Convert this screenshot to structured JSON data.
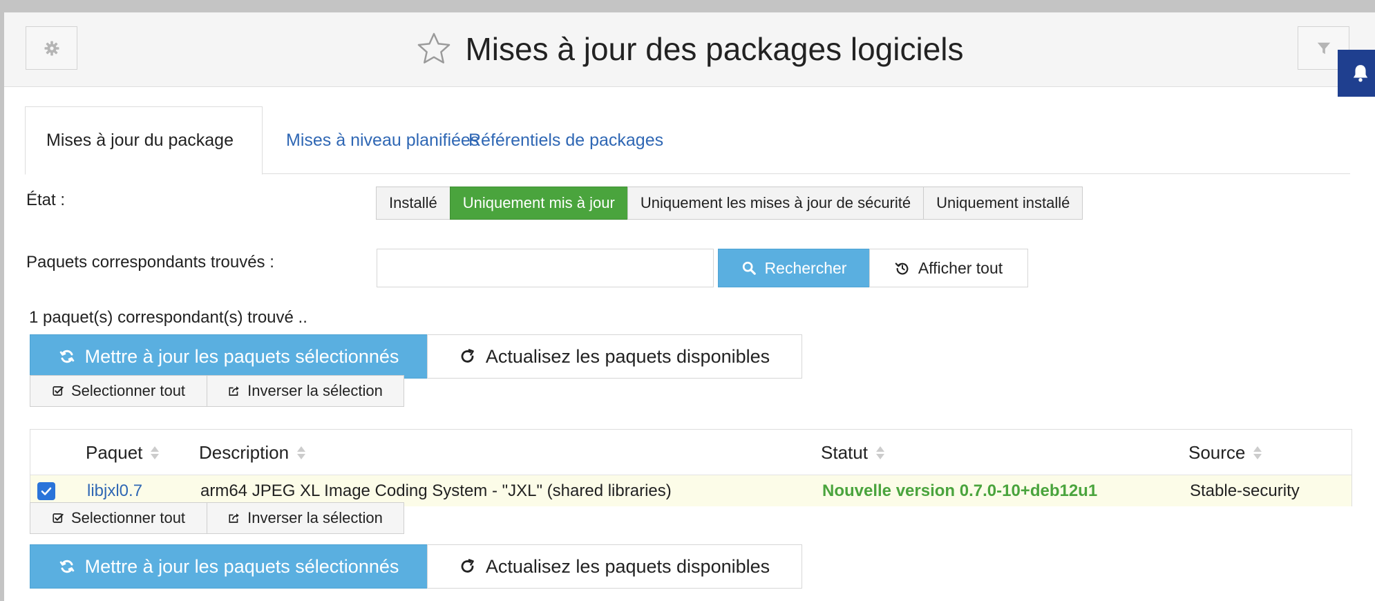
{
  "header": {
    "title": "Mises à jour des packages logiciels"
  },
  "tabs": [
    {
      "label": "Mises à jour du package",
      "active": true
    },
    {
      "label": "Mises à niveau planifiées",
      "active": false
    },
    {
      "label": "Référentiels de packages",
      "active": false
    }
  ],
  "state": {
    "label": "État :",
    "options": [
      "Installé",
      "Uniquement mis à jour",
      "Uniquement les mises à jour de sécurité",
      "Uniquement installé"
    ],
    "selected": "Uniquement mis à jour"
  },
  "search": {
    "label": "Paquets correspondants trouvés :",
    "value": "",
    "search_button": "Rechercher",
    "show_all_button": "Afficher tout"
  },
  "results": {
    "count_text": "1 paquet(s) correspondant(s) trouvé .."
  },
  "actions": {
    "update_selected": "Mettre à jour les paquets sélectionnés",
    "refresh_available": "Actualisez les paquets disponibles",
    "select_all": "Selectionner tout",
    "invert_selection": "Inverser la sélection"
  },
  "table": {
    "columns": [
      "Paquet",
      "Description",
      "Statut",
      "Source"
    ],
    "rows": [
      {
        "checked": true,
        "package": "libjxl0.7",
        "description": "arm64 JPEG XL Image Coding System - \"JXL\" (shared libraries)",
        "status": "Nouvelle version 0.7.0-10+deb12u1",
        "source": "Stable-security"
      }
    ]
  },
  "colors": {
    "accent_blue": "#5aafe0",
    "active_green": "#4aa43d",
    "link_blue": "#2f67b4",
    "notification_bar": "#1f3f8f",
    "row_highlight": "#fcfce8"
  }
}
